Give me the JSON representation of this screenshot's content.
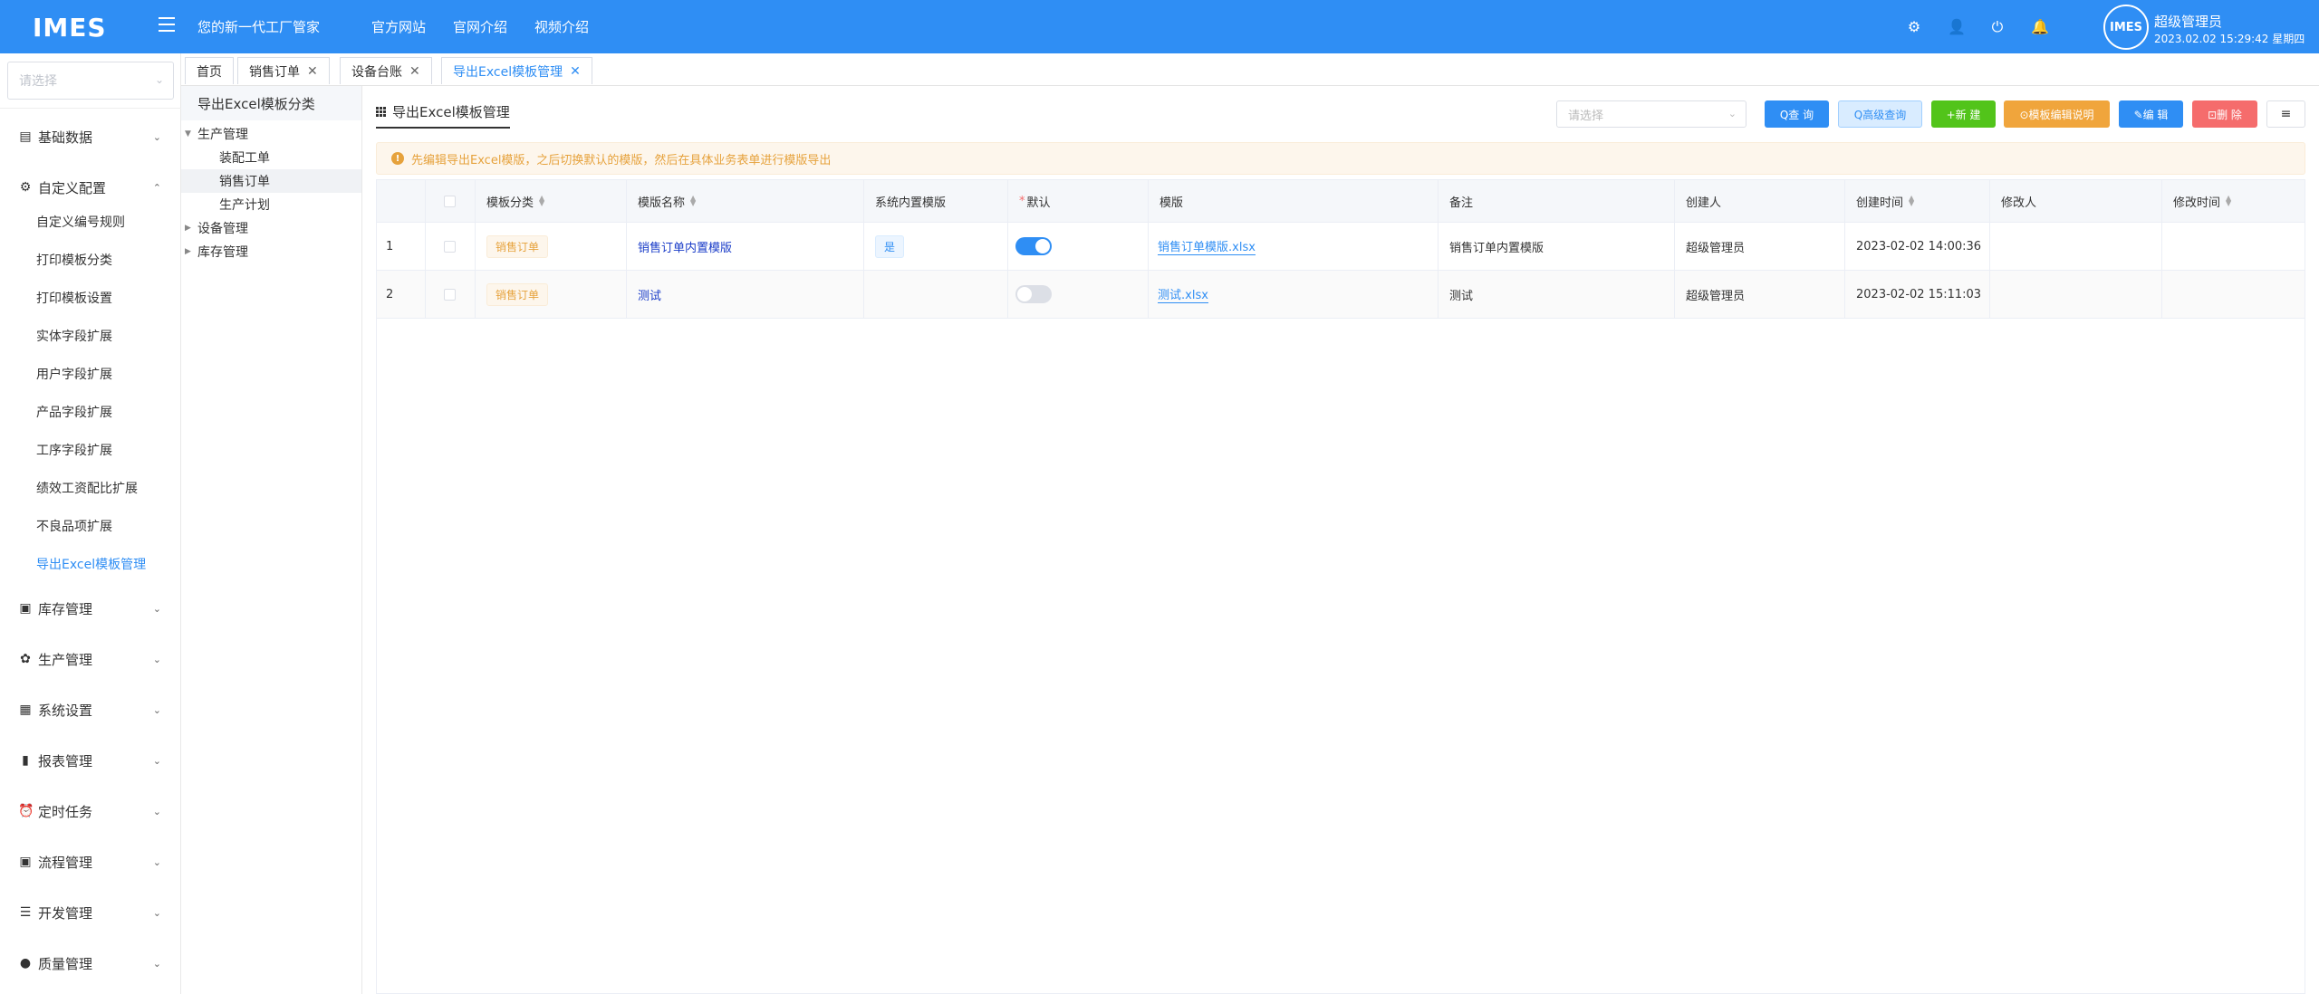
{
  "header": {
    "logo": "IMES",
    "slogan": "您的新一代工厂管家",
    "nav": [
      "官方网站",
      "官网介绍",
      "视频介绍"
    ],
    "user_name": "超级管理员",
    "datetime": "2023.02.02 15:29:42 星期四",
    "avatar_text": "IMES",
    "icons": [
      "gear-icon",
      "user-icon",
      "power-icon",
      "bell-icon"
    ]
  },
  "sidebar": {
    "select_placeholder": "请选择",
    "groups": [
      {
        "label": "基础数据",
        "icon": "document-icon"
      },
      {
        "label": "自定义配置",
        "icon": "settings-icon"
      },
      {
        "label": "库存管理",
        "icon": "clipboard-icon"
      },
      {
        "label": "生产管理",
        "icon": "gear-icon"
      },
      {
        "label": "系统设置",
        "icon": "grid-icon"
      },
      {
        "label": "报表管理",
        "icon": "bar-chart-icon"
      },
      {
        "label": "定时任务",
        "icon": "alarm-icon"
      },
      {
        "label": "流程管理",
        "icon": "flow-icon"
      },
      {
        "label": "开发管理",
        "icon": "sliders-icon"
      },
      {
        "label": "质量管理",
        "icon": "alert-icon"
      }
    ],
    "sub_items": [
      "自定义编号规则",
      "打印模板分类",
      "打印模板设置",
      "实体字段扩展",
      "用户字段扩展",
      "产品字段扩展",
      "工序字段扩展",
      "绩效工资配比扩展",
      "不良品项扩展",
      "导出Excel模板管理"
    ]
  },
  "tabs": [
    {
      "label": "首页"
    },
    {
      "label": "销售订单"
    },
    {
      "label": "设备台账"
    },
    {
      "label": "导出Excel模板管理"
    }
  ],
  "category": {
    "title": "导出Excel模板分类",
    "tree": [
      {
        "label": "生产管理"
      },
      {
        "label": "装配工单"
      },
      {
        "label": "销售订单"
      },
      {
        "label": "生产计划"
      },
      {
        "label": "设备管理"
      },
      {
        "label": "库存管理"
      }
    ]
  },
  "main": {
    "title": "导出Excel模板管理",
    "select_placeholder": "请选择",
    "buttons": {
      "query": "Q查 询",
      "advanced": "Q高级查询",
      "new": "+新 建",
      "help": "⊙模板编辑说明",
      "edit": "✎编 辑",
      "delete": "⊡删 除",
      "columns": "≡"
    },
    "alert": "先编辑导出Excel模版，之后切换默认的模版，然后在具体业务表单进行模版导出"
  },
  "table": {
    "headers": [
      "模板分类",
      "模版名称",
      "系统内置模版",
      "默认",
      "模版",
      "备注",
      "创建人",
      "创建时间",
      "修改人",
      "修改时间"
    ],
    "rows": [
      {
        "index": "1",
        "category": "销售订单",
        "name": "销售订单内置模版",
        "builtin": "是",
        "default": true,
        "file": "销售订单模版.xlsx",
        "remark": "销售订单内置模版",
        "creator": "超级管理员",
        "created": "2023-02-02 14:00:36",
        "modifier": "",
        "modified": ""
      },
      {
        "index": "2",
        "category": "销售订单",
        "name": "测试",
        "builtin": "",
        "default": false,
        "file": "测试.xlsx",
        "remark": "测试",
        "creator": "超级管理员",
        "created": "2023-02-02 15:11:03",
        "modifier": "",
        "modified": ""
      }
    ]
  },
  "colors": {
    "primary": "#2f8ef4",
    "advanced_btn": "#d9ecff",
    "new_btn": "#52c41a",
    "help_btn": "#f0a53c",
    "delete_btn": "#f56c6c",
    "warning": "#e6a23c"
  }
}
